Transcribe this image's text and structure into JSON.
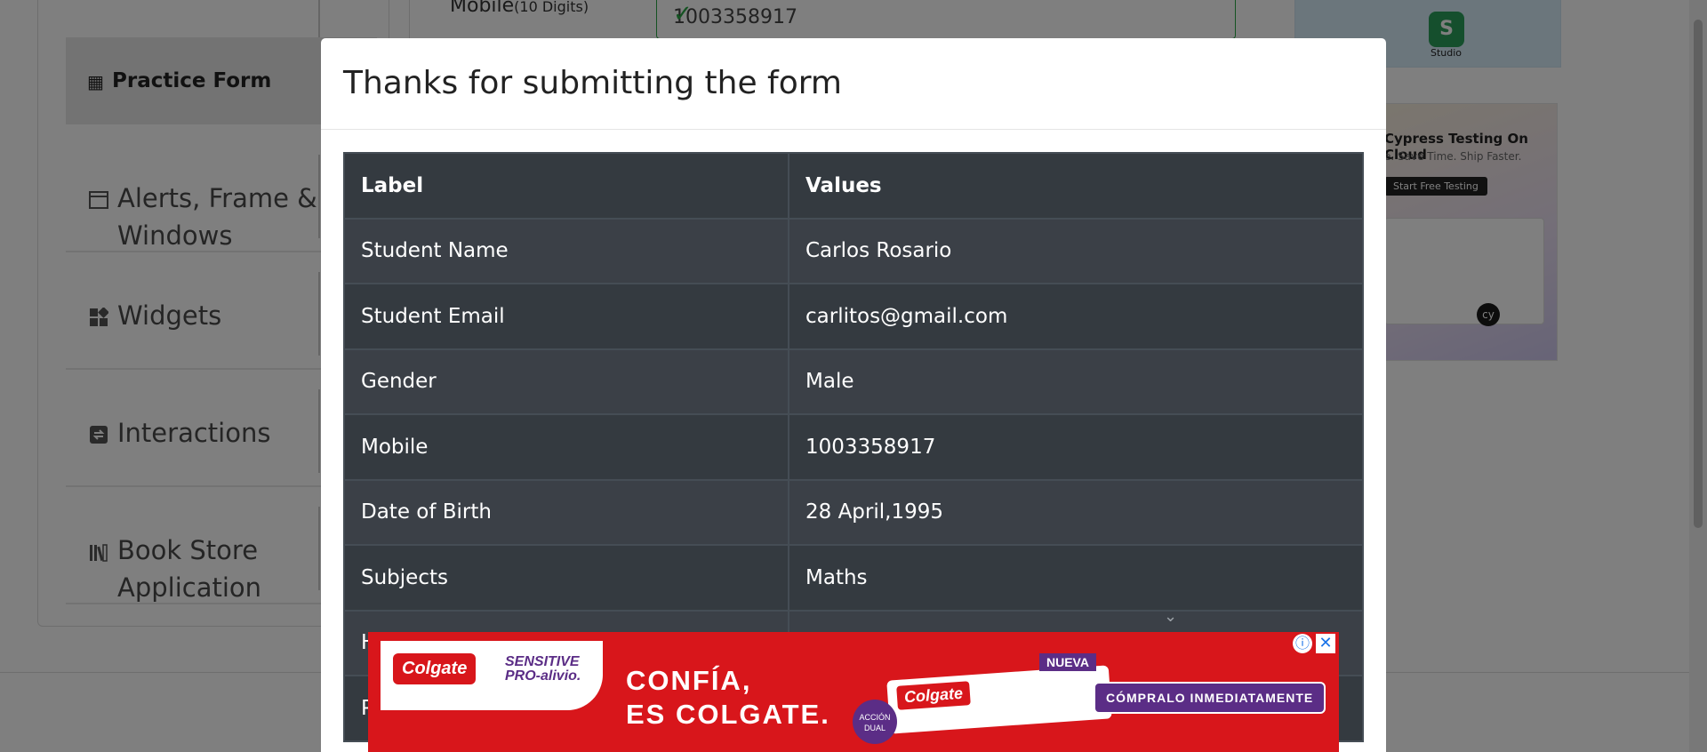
{
  "sidebar": {
    "practice_form": "Practice Form",
    "items": [
      {
        "label": "Alerts, Frame &",
        "label2": "Windows",
        "icon": "window-icon"
      },
      {
        "label": "Widgets",
        "icon": "widgets-icon"
      },
      {
        "label": "Interactions",
        "icon": "interactions-icon"
      },
      {
        "label": "Book Store",
        "label2": "Application",
        "icon": "book-icon"
      }
    ]
  },
  "form": {
    "mobile_label": "Mobile",
    "mobile_hint": "(10 Digits)",
    "mobile_value": "1003358917"
  },
  "ads_right": {
    "studio": "Studio",
    "cypress_title": "Cypress Testing On Cloud",
    "cypress_sub": "e. Save Time. Ship Faster.",
    "cypress_button": "Start Free Testing",
    "cypress_badge": "cy"
  },
  "modal": {
    "title": "Thanks for submitting the form",
    "headers": [
      "Label",
      "Values"
    ],
    "rows": [
      {
        "label": "Student Name",
        "value": "Carlos Rosario"
      },
      {
        "label": "Student Email",
        "value": "carlitos@gmail.com"
      },
      {
        "label": "Gender",
        "value": "Male"
      },
      {
        "label": "Mobile",
        "value": "1003358917"
      },
      {
        "label": "Date of Birth",
        "value": "28 April,1995"
      },
      {
        "label": "Subjects",
        "value": "Maths"
      },
      {
        "label": "H",
        "value": ""
      },
      {
        "label": "P",
        "value": ""
      }
    ]
  },
  "bottom_ad": {
    "brand": "Colgate",
    "sub_brand": "SENSITIVE PRO-alivio.",
    "headline_1": "CONFÍA,",
    "headline_2": "ES COLGATE.",
    "nueva": "NUEVA",
    "dual": "ACCIÓN DUAL",
    "cta": "CÓMPRALO INMEDIATAMENTE",
    "info": "ⓘ",
    "close": "✕"
  }
}
